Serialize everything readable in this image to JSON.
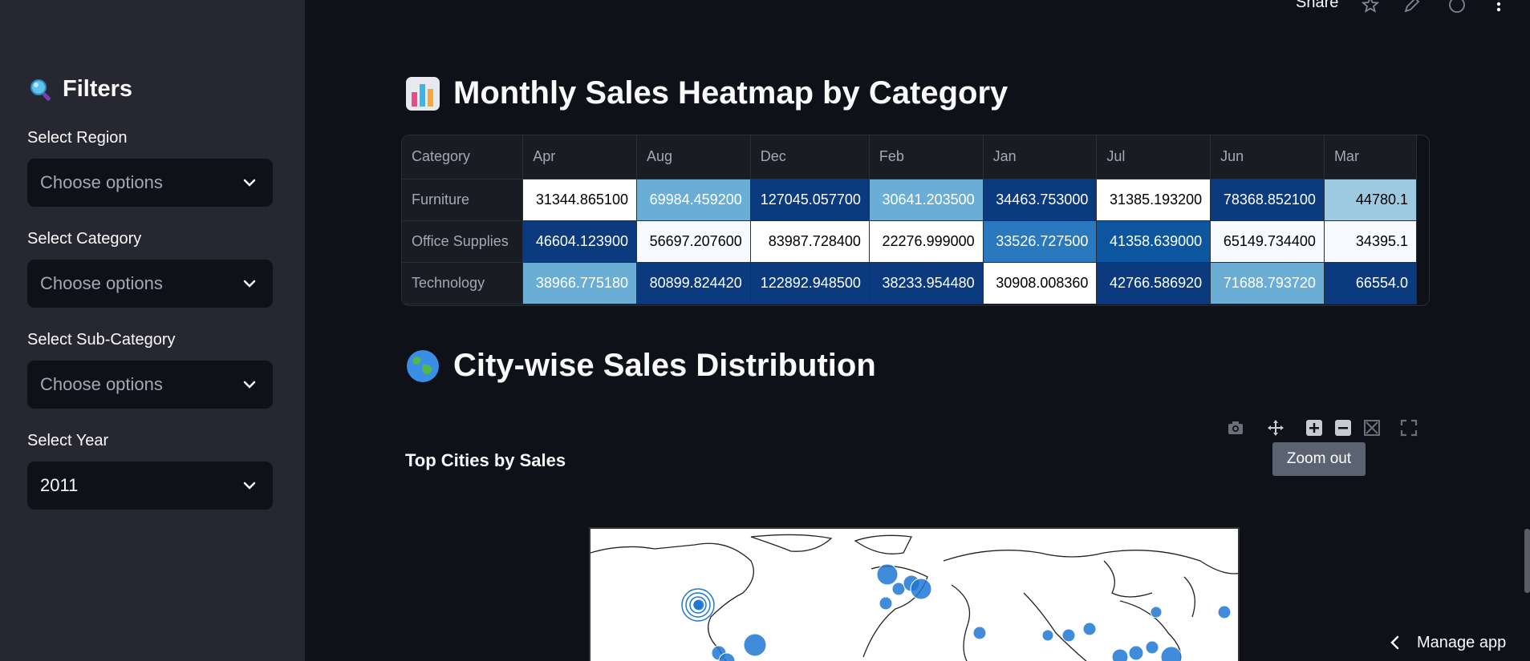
{
  "sidebar": {
    "title": "Filters",
    "filters": [
      {
        "label": "Select Region",
        "placeholder": "Choose options",
        "value": ""
      },
      {
        "label": "Select Category",
        "placeholder": "Choose options",
        "value": ""
      },
      {
        "label": "Select Sub-Category",
        "placeholder": "Choose options",
        "value": ""
      },
      {
        "label": "Select Year",
        "placeholder": "",
        "value": "2011"
      }
    ]
  },
  "header": {
    "share_label": "Share"
  },
  "heatmap_section": {
    "title": "Monthly Sales Heatmap by Category",
    "columns": [
      "Category",
      "Apr",
      "Aug",
      "Dec",
      "Feb",
      "Jan",
      "Jul",
      "Jun",
      "Mar"
    ],
    "rows": [
      {
        "category": "Furniture",
        "values": [
          "31344.865100",
          "69984.459200",
          "127045.057700",
          "30641.203500",
          "34463.753000",
          "31385.193200",
          "78368.852100",
          "44780.1"
        ]
      },
      {
        "category": "Office Supplies",
        "values": [
          "46604.123900",
          "56697.207600",
          "83987.728400",
          "22276.999000",
          "33526.727500",
          "41358.639000",
          "65149.734400",
          "34395.1"
        ]
      },
      {
        "category": "Technology",
        "values": [
          "38966.775180",
          "80899.824420",
          "122892.948500",
          "38233.954480",
          "30908.008360",
          "42766.586920",
          "71688.793720",
          "66554.0"
        ]
      }
    ],
    "cell_colors": [
      [
        "#ffffff",
        "#6aaed6",
        "#0b3a7e",
        "#6aaed6",
        "#0b3a7e",
        "#ffffff",
        "#0b3a7e",
        "#9ecae1"
      ],
      [
        "#0b3a7e",
        "#f7fbff",
        "#ffffff",
        "#ffffff",
        "#2a78bd",
        "#0c56a0",
        "#f7fbff",
        "#f7fbff"
      ],
      [
        "#6aaed6",
        "#0b3a7e",
        "#0b3a7e",
        "#0b3a7e",
        "#ffffff",
        "#0b3a7e",
        "#6aaed6",
        "#0b3a7e"
      ]
    ],
    "text_colors": [
      [
        "#000000",
        "#ffffff",
        "#ffffff",
        "#ffffff",
        "#ffffff",
        "#000000",
        "#ffffff",
        "#000000"
      ],
      [
        "#ffffff",
        "#000000",
        "#000000",
        "#000000",
        "#ffffff",
        "#ffffff",
        "#000000",
        "#000000"
      ],
      [
        "#ffffff",
        "#ffffff",
        "#ffffff",
        "#ffffff",
        "#000000",
        "#ffffff",
        "#ffffff",
        "#ffffff"
      ]
    ]
  },
  "city_section": {
    "title": "City-wise Sales Distribution",
    "chart_title": "Top Cities by Sales",
    "tooltip": "Zoom out"
  },
  "footer": {
    "manage_label": "Manage app"
  },
  "colors": {
    "background": "#0e1117",
    "sidebar": "#262730",
    "accent_marker": "#1f77d4"
  }
}
